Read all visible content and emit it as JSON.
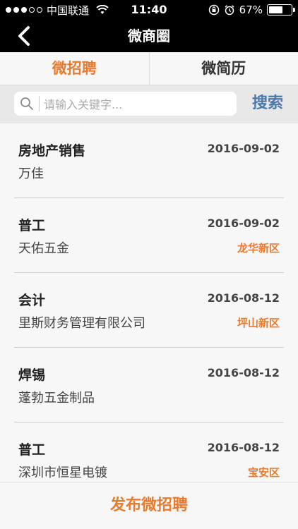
{
  "status_bar": {
    "carrier": "中国联通",
    "time": "11:40",
    "battery_percent": "67%",
    "battery_level": 0.67
  },
  "nav": {
    "title": "微商圈",
    "back_icon": "chevron-left-icon"
  },
  "tabs": [
    {
      "label": "微招聘",
      "active": true
    },
    {
      "label": "微简历",
      "active": false
    }
  ],
  "search": {
    "placeholder": "请输入关键字...",
    "button_label": "搜索"
  },
  "jobs": [
    {
      "title": "房地产销售",
      "date": "2016-09-02",
      "company": "万佳",
      "location": ""
    },
    {
      "title": "普工",
      "date": "2016-09-02",
      "company": "天佑五金",
      "location": "龙华新区"
    },
    {
      "title": "会计",
      "date": "2016-08-12",
      "company": "里斯财务管理有限公司",
      "location": "坪山新区"
    },
    {
      "title": "焊锡",
      "date": "2016-08-12",
      "company": "蓬勃五金制品",
      "location": ""
    },
    {
      "title": "普工",
      "date": "2016-08-12",
      "company": "深圳市恒星电镀",
      "location": "宝安区"
    }
  ],
  "bottom": {
    "publish_label": "发布微招聘"
  },
  "colors": {
    "accent": "#e87b2f",
    "search_button": "#4d7aa8"
  }
}
